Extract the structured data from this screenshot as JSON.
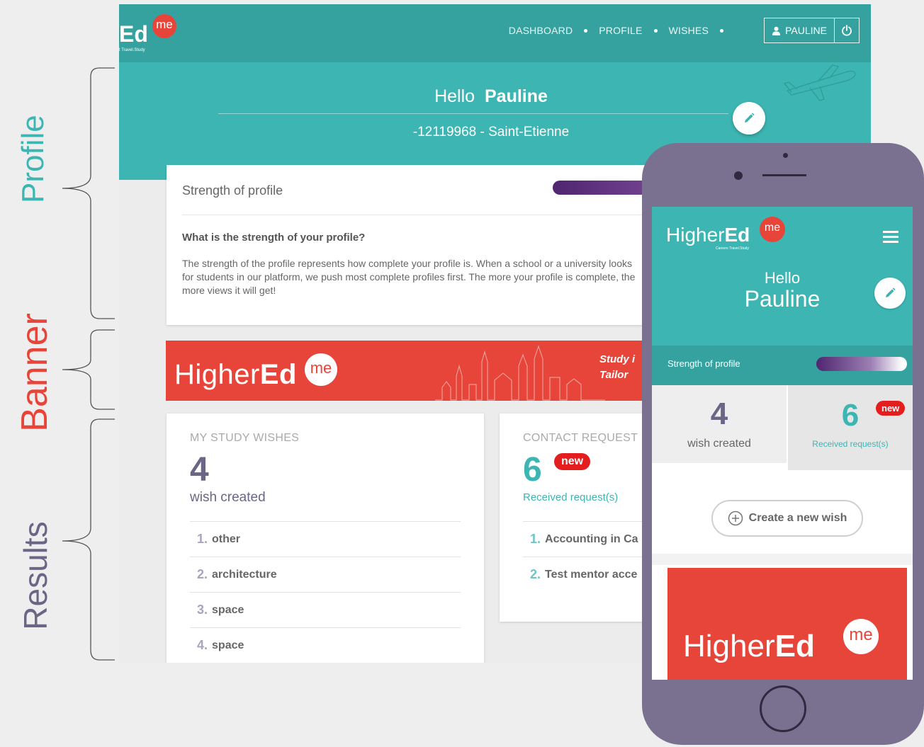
{
  "annotations": {
    "profile": "Profile",
    "banner": "Banner",
    "results": "Results"
  },
  "desktop": {
    "logo": {
      "text": "Ed",
      "badge": "me",
      "tagline": "t Travel.Study"
    },
    "nav": [
      {
        "label": "DASHBOARD"
      },
      {
        "label": "PROFILE"
      },
      {
        "label": "WISHES"
      }
    ],
    "user": {
      "name": "PAULINE"
    },
    "hero": {
      "greeting": "Hello",
      "name": "Pauline",
      "subtitle": "-12119968 - Saint-Etienne"
    },
    "strength": {
      "title": "Strength of profile",
      "question": "What is the strength of your profile?",
      "description": "The strength of the profile represents how complete your profile is. When a school or a university looks for students in our platform, we push most complete profiles first. The more your profile is complete, the more views it will get!"
    },
    "banner": {
      "logo_light": "Higher",
      "logo_bold": "Ed",
      "badge": "me",
      "tagline_line1": "Study i",
      "tagline_line2": "Tailor"
    },
    "wishes": {
      "title": "MY STUDY WISHES",
      "count": "4",
      "count_label": "wish created",
      "items": [
        {
          "num": "1.",
          "label": "other"
        },
        {
          "num": "2.",
          "label": "architecture"
        },
        {
          "num": "3.",
          "label": "space"
        },
        {
          "num": "4.",
          "label": "space"
        }
      ]
    },
    "contacts": {
      "title": "CONTACT REQUEST",
      "count": "6",
      "badge": "new",
      "count_label": "Received request(s)",
      "items": [
        {
          "num": "1.",
          "label": "Accounting in Ca"
        },
        {
          "num": "2.",
          "label": "Test mentor acce"
        }
      ]
    }
  },
  "mobile": {
    "logo_light": "Higher",
    "logo_bold": "Ed",
    "badge": "me",
    "tagline": "Careers Travel.Study",
    "greeting": "Hello",
    "name": "Pauline",
    "strength_label": "Strength of profile",
    "wish_count": "4",
    "wish_label": "wish created",
    "request_count": "6",
    "request_badge": "new",
    "request_label": "Received request(s)",
    "create_label": "Create a new wish",
    "banner_logo_light": "Higher",
    "banner_logo_bold": "Ed",
    "banner_badge": "me"
  },
  "colors": {
    "teal": "#3cb5b3",
    "teal_dark": "#36a2a0",
    "red": "#e8453a",
    "purple": "#6c6686",
    "phone": "#7a7191"
  }
}
